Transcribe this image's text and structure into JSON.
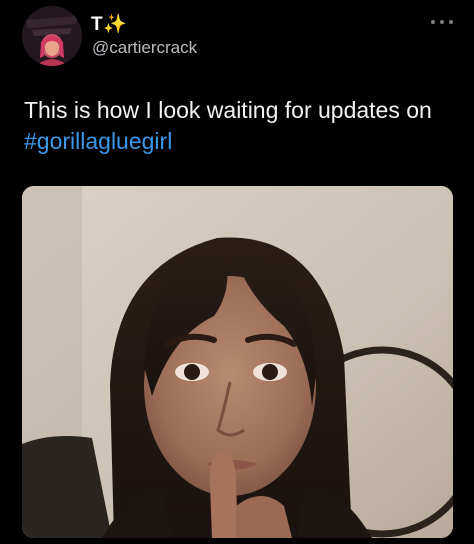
{
  "tweet": {
    "display_name": "T✨",
    "handle": "@cartiercrack",
    "text_main": "This is how I look waiting for updates on",
    "hashtag": "#gorillagluegirl",
    "more_icon": "more-horizontal-icon",
    "avatar_icon": "profile-avatar",
    "media_icon": "photo-woman-thinking"
  },
  "colors": {
    "background": "#000000",
    "text": "#f2f3f4",
    "handle": "#b9bcc0",
    "hashtag": "#3b98ea"
  }
}
